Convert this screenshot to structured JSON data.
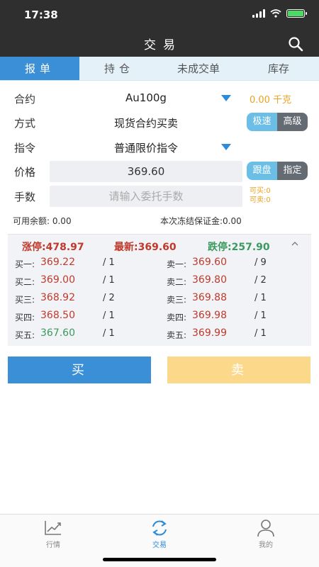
{
  "status": {
    "time": "17:38"
  },
  "nav": {
    "title": "交易"
  },
  "tabs": [
    "报单",
    "持仓",
    "未成交单",
    "库存"
  ],
  "form": {
    "contract_label": "合约",
    "contract_value": "Au100g",
    "contract_qty": "0.00 千克",
    "mode_label": "方式",
    "mode_value": "现货合约买卖",
    "mode_fast": "极速",
    "mode_adv": "高级",
    "order_label": "指令",
    "order_value": "普通限价指令",
    "price_label": "价格",
    "price_value": "369.60",
    "price_follow": "跟盘",
    "price_fixed": "指定",
    "lots_label": "手数",
    "lots_placeholder": "请输入委托手数",
    "can_buy": "可买:0",
    "can_sell": "可卖:0"
  },
  "balance": {
    "available": "可用余额: 0.00",
    "frozen": "本次冻结保证金:0.00"
  },
  "quote": {
    "limit_up": "涨停:478.97",
    "latest": "最新:369.60",
    "limit_down": "跌停:257.90",
    "bids": [
      {
        "label": "买一:",
        "price": "369.22",
        "vol": "/ 1"
      },
      {
        "label": "买二:",
        "price": "369.00",
        "vol": "/ 1"
      },
      {
        "label": "买三:",
        "price": "368.92",
        "vol": "/ 2"
      },
      {
        "label": "买四:",
        "price": "368.50",
        "vol": "/ 1"
      },
      {
        "label": "买五:",
        "price": "367.60",
        "vol": "/ 1"
      }
    ],
    "asks": [
      {
        "label": "卖一:",
        "price": "369.60",
        "vol": "/ 9"
      },
      {
        "label": "卖二:",
        "price": "369.80",
        "vol": "/ 2"
      },
      {
        "label": "卖三:",
        "price": "369.88",
        "vol": "/ 1"
      },
      {
        "label": "卖四:",
        "price": "369.98",
        "vol": "/ 1"
      },
      {
        "label": "卖五:",
        "price": "369.99",
        "vol": "/ 1"
      }
    ]
  },
  "actions": {
    "buy": "买",
    "sell": "卖"
  },
  "bottom_nav": [
    {
      "label": "行情",
      "icon": "chart-line-icon"
    },
    {
      "label": "交易",
      "icon": "refresh-icon"
    },
    {
      "label": "我的",
      "icon": "user-icon"
    }
  ],
  "colors": {
    "accent": "#3b8fd6",
    "sell": "#fbd88a",
    "up": "#c0392b",
    "down": "#3c9a5f",
    "warn": "#f0a020"
  }
}
